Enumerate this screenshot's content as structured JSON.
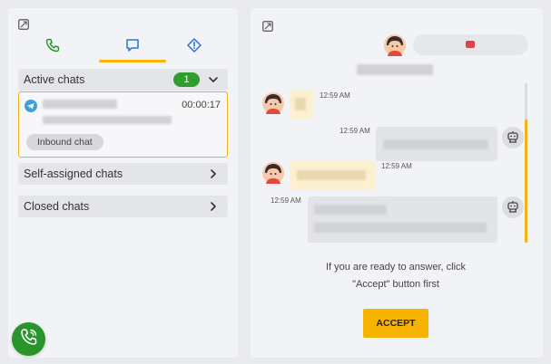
{
  "left_panel": {
    "tabs": [
      {
        "name": "calls",
        "icon": "phone-icon",
        "color": "#27952c"
      },
      {
        "name": "chats",
        "icon": "chat-bubble-icon",
        "color": "#2a73d9",
        "active": true
      },
      {
        "name": "alerts",
        "icon": "alert-icon",
        "color": "#2a73d9"
      }
    ],
    "active_chats": {
      "label": "Active chats",
      "count": "1"
    },
    "chat_card": {
      "timer": "00:00:17",
      "tag": "Inbound chat"
    },
    "self_assigned": {
      "label": "Self-assigned chats"
    },
    "closed": {
      "label": "Closed chats"
    }
  },
  "right_panel": {
    "messages": [
      {
        "time": "12:59 AM"
      },
      {
        "time": "12:59 AM"
      },
      {
        "time": "12:59 AM"
      },
      {
        "time": "12:59 AM"
      }
    ],
    "hint_line1": "If you are ready to answer, click",
    "hint_line2": "\"Accept\" button first",
    "accept_label": "ACCEPT"
  },
  "colors": {
    "accent": "#f6b400",
    "green": "#27952c",
    "blue": "#2a73d9",
    "red": "#e0424a"
  }
}
